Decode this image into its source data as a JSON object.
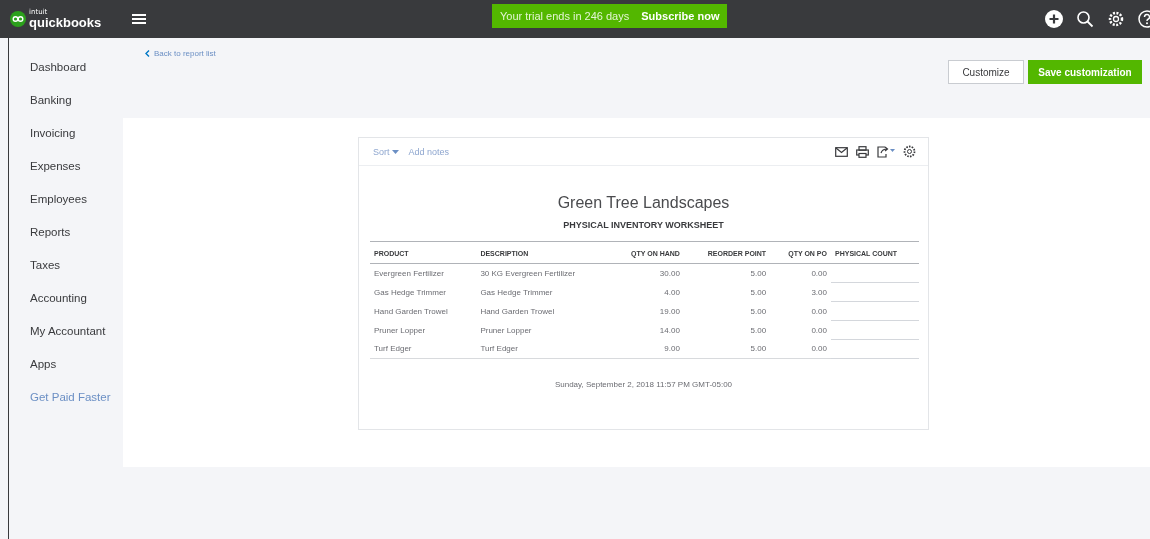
{
  "topbar": {
    "brand_small": "intuit",
    "brand": "quickbooks",
    "trial_text": "Your trial ends in 246 days",
    "subscribe": "Subscribe now"
  },
  "sidebar": {
    "items": [
      {
        "label": "Dashboard",
        "kind": "nav"
      },
      {
        "label": "Banking",
        "kind": "nav"
      },
      {
        "label": "Invoicing",
        "kind": "nav"
      },
      {
        "label": "Expenses",
        "kind": "nav"
      },
      {
        "label": "Employees",
        "kind": "nav"
      },
      {
        "label": "Reports",
        "kind": "nav"
      },
      {
        "label": "Taxes",
        "kind": "nav"
      },
      {
        "label": "Accounting",
        "kind": "nav"
      },
      {
        "label": "My Accountant",
        "kind": "nav"
      },
      {
        "label": "Apps",
        "kind": "nav"
      },
      {
        "label": "Get Paid Faster",
        "kind": "promo"
      }
    ]
  },
  "back_link": "Back to report list",
  "buttons": {
    "customize": "Customize",
    "save": "Save customization"
  },
  "report": {
    "toolbar": {
      "sort": "Sort",
      "add_notes": "Add notes"
    },
    "company": "Green Tree Landscapes",
    "title": "PHYSICAL INVENTORY WORKSHEET",
    "columns": [
      "PRODUCT",
      "DESCRIPTION",
      "QTY ON HAND",
      "REORDER POINT",
      "QTY ON PO",
      "PHYSICAL COUNT"
    ],
    "rows": [
      [
        "Evergreen Fertilizer",
        "30 KG Evergreen Fertilizer",
        "30.00",
        "5.00",
        "0.00"
      ],
      [
        "Gas Hedge Trimmer",
        "Gas Hedge Trimmer",
        "4.00",
        "5.00",
        "3.00"
      ],
      [
        "Hand Garden Trowel",
        "Hand Garden Trowel",
        "19.00",
        "5.00",
        "0.00"
      ],
      [
        "Pruner Lopper",
        "Pruner Lopper",
        "14.00",
        "5.00",
        "0.00"
      ],
      [
        "Turf Edger",
        "Turf Edger",
        "9.00",
        "5.00",
        "0.00"
      ]
    ],
    "footer": "Sunday, September 2, 2018  11:57 PM GMT-05:00"
  }
}
